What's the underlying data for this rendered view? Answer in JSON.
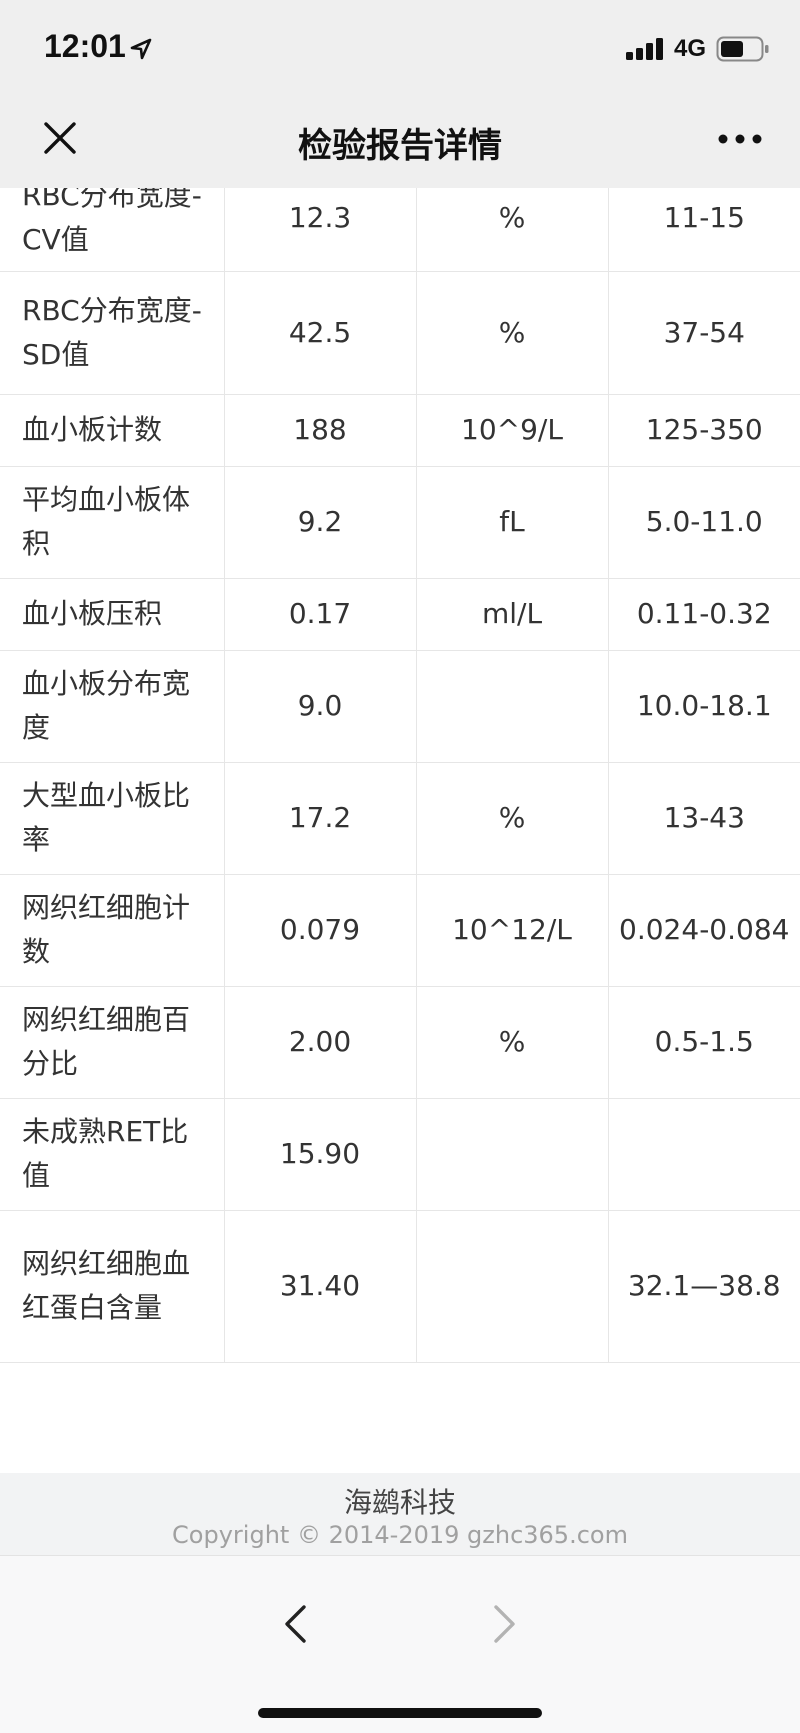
{
  "status_bar": {
    "time": "12:01",
    "network": "4G"
  },
  "nav": {
    "title": "检验报告详情"
  },
  "table": {
    "rows": [
      {
        "name": "RBC分布宽度-CV值",
        "value": "12.3",
        "unit": "%",
        "range": "11-15"
      },
      {
        "name": "RBC分布宽度-SD值",
        "value": "42.5",
        "unit": "%",
        "range": "37-54"
      },
      {
        "name": "血小板计数",
        "value": "188",
        "unit": "10^9/L",
        "range": "125-350"
      },
      {
        "name": "平均血小板体积",
        "value": "9.2",
        "unit": "fL",
        "range": "5.0-11.0"
      },
      {
        "name": "血小板压积",
        "value": "0.17",
        "unit": "ml/L",
        "range": "0.11-0.32"
      },
      {
        "name": "血小板分布宽度",
        "value": "9.0",
        "unit": "",
        "range": "10.0-18.1"
      },
      {
        "name": "大型血小板比率",
        "value": "17.2",
        "unit": "%",
        "range": "13-43"
      },
      {
        "name": "网织红细胞计数",
        "value": "0.079",
        "unit": "10^12/L",
        "range": "0.024-0.084"
      },
      {
        "name": "网织红细胞百分比",
        "value": "2.00",
        "unit": "%",
        "range": "0.5-1.5"
      },
      {
        "name": "未成熟RET比值",
        "value": "15.90",
        "unit": "",
        "range": ""
      },
      {
        "name": "网织红细胞血红蛋白含量",
        "value": "31.40",
        "unit": "",
        "range": "32.1—38.8"
      }
    ]
  },
  "footer": {
    "brand": "海鹚科技",
    "copyright": "Copyright © 2014-2019 gzhc365.com"
  },
  "icons": {
    "close": "close-icon",
    "more": "more-icon",
    "back": "chevron-left-icon",
    "forward": "chevron-right-icon"
  },
  "colors": {
    "bar_bg": "#efefef",
    "border": "#e6e6e6",
    "text": "#333333",
    "muted": "#a0a0a0"
  }
}
